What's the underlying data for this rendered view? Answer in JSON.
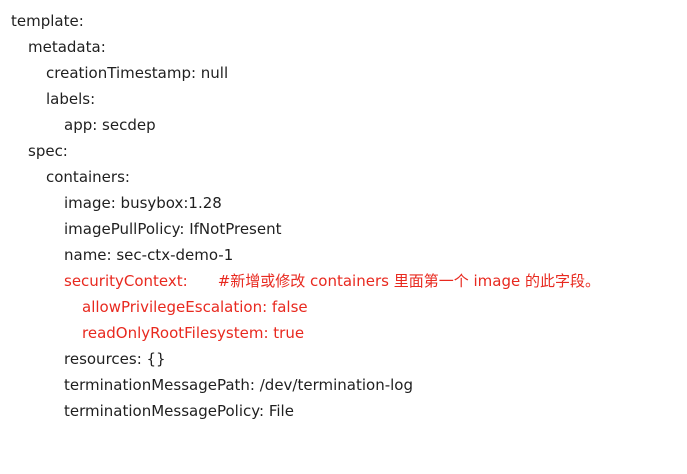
{
  "yaml": {
    "template": "template:",
    "metadata": "metadata:",
    "creationTimestamp": "creationTimestamp: null",
    "labels": "labels:",
    "app": "app: secdep",
    "spec": "spec:",
    "containers": "containers:",
    "image": "image: busybox:1.28",
    "imagePullPolicy": "imagePullPolicy: IfNotPresent",
    "name": "name: sec-ctx-demo-1",
    "securityContext": "securityContext:",
    "securityComment": "#新增或修改 containers 里面第一个 image 的此字段。",
    "allowPrivilegeEscalation": "allowPrivilegeEscalation: false",
    "readOnlyRootFilesystem": "readOnlyRootFilesystem: true",
    "resources": "resources: {}",
    "terminationMessagePath": "terminationMessagePath: /dev/termination-log",
    "terminationMessagePolicy": "terminationMessagePolicy: File"
  },
  "colors": {
    "text": "#1f1f1f",
    "highlight": "#e8291f"
  }
}
